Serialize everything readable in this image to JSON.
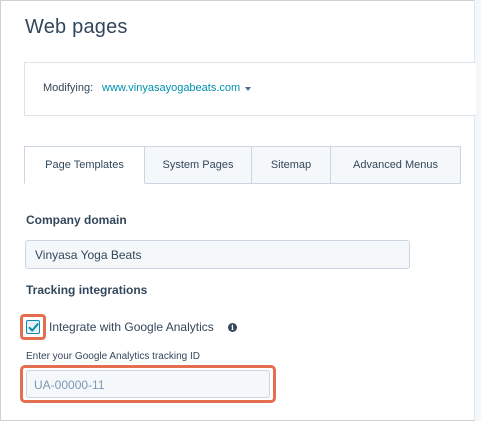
{
  "page": {
    "title": "Web pages"
  },
  "modifying": {
    "label": "Modifying:",
    "domain": "www.vinyasayogabeats.com"
  },
  "tabs": [
    {
      "label": "Page Templates",
      "active": true
    },
    {
      "label": "System Pages",
      "active": false
    },
    {
      "label": "Sitemap",
      "active": false
    },
    {
      "label": "Advanced Menus",
      "active": false
    }
  ],
  "company_domain": {
    "label": "Company domain",
    "value": "Vinyasa Yoga Beats"
  },
  "tracking": {
    "label": "Tracking integrations",
    "ga_checkbox_label": "Integrate with Google Analytics",
    "ga_checked": true,
    "ga_id_label": "Enter your Google Analytics tracking ID",
    "ga_id_placeholder": "UA-00000-11"
  },
  "colors": {
    "accent": "#0091ae",
    "highlight": "#e66e50",
    "text": "#33475b"
  }
}
